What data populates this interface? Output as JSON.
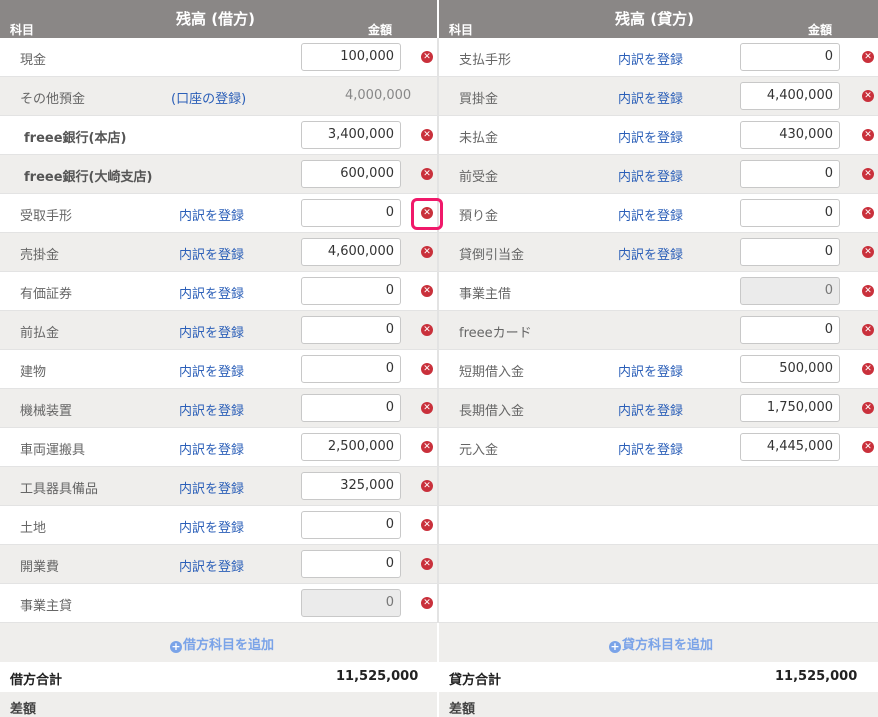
{
  "header": {
    "debit_title": "残高 (借方)",
    "credit_title": "残高 (貸方)",
    "account_label": "科目",
    "amount_label": "金額"
  },
  "debit": [
    {
      "name": "現金",
      "link": "",
      "amount": "100,000",
      "kind": "input",
      "del": true
    },
    {
      "name": "その他預金",
      "link": "(口座の登録)",
      "amount": "4,000,000",
      "kind": "static",
      "del": false
    },
    {
      "name": "freee銀行(本店)",
      "link": "",
      "amount": "3,400,000",
      "kind": "input",
      "del": true,
      "bold": true
    },
    {
      "name": "freee銀行(大崎支店)",
      "link": "",
      "amount": "600,000",
      "kind": "input",
      "del": true,
      "bold": true
    },
    {
      "name": "受取手形",
      "link": "内訳を登録",
      "amount": "0",
      "kind": "input",
      "del": true
    },
    {
      "name": "売掛金",
      "link": "内訳を登録",
      "amount": "4,600,000",
      "kind": "input",
      "del": true
    },
    {
      "name": "有価証券",
      "link": "内訳を登録",
      "amount": "0",
      "kind": "input",
      "del": true
    },
    {
      "name": "前払金",
      "link": "内訳を登録",
      "amount": "0",
      "kind": "input",
      "del": true
    },
    {
      "name": "建物",
      "link": "内訳を登録",
      "amount": "0",
      "kind": "input",
      "del": true
    },
    {
      "name": "機械装置",
      "link": "内訳を登録",
      "amount": "0",
      "kind": "input",
      "del": true
    },
    {
      "name": "車両運搬具",
      "link": "内訳を登録",
      "amount": "2,500,000",
      "kind": "input",
      "del": true
    },
    {
      "name": "工具器具備品",
      "link": "内訳を登録",
      "amount": "325,000",
      "kind": "input",
      "del": true
    },
    {
      "name": "土地",
      "link": "内訳を登録",
      "amount": "0",
      "kind": "input",
      "del": true
    },
    {
      "name": "開業費",
      "link": "内訳を登録",
      "amount": "0",
      "kind": "input",
      "del": true
    },
    {
      "name": "事業主貸",
      "link": "",
      "amount": "0",
      "kind": "disabled",
      "del": true
    }
  ],
  "credit": [
    {
      "name": "支払手形",
      "link": "内訳を登録",
      "amount": "0",
      "kind": "input",
      "del": true
    },
    {
      "name": "買掛金",
      "link": "内訳を登録",
      "amount": "4,400,000",
      "kind": "input",
      "del": true
    },
    {
      "name": "未払金",
      "link": "内訳を登録",
      "amount": "430,000",
      "kind": "input",
      "del": true
    },
    {
      "name": "前受金",
      "link": "内訳を登録",
      "amount": "0",
      "kind": "input",
      "del": true
    },
    {
      "name": "預り金",
      "link": "内訳を登録",
      "amount": "0",
      "kind": "input",
      "del": true
    },
    {
      "name": "貸倒引当金",
      "link": "内訳を登録",
      "amount": "0",
      "kind": "input",
      "del": true
    },
    {
      "name": "事業主借",
      "link": "",
      "amount": "0",
      "kind": "disabled",
      "del": true
    },
    {
      "name": "freeeカード",
      "link": "",
      "amount": "0",
      "kind": "input",
      "del": true
    },
    {
      "name": "短期借入金",
      "link": "内訳を登録",
      "amount": "500,000",
      "kind": "input",
      "del": true
    },
    {
      "name": "長期借入金",
      "link": "内訳を登録",
      "amount": "1,750,000",
      "kind": "input",
      "del": true
    },
    {
      "name": "元入金",
      "link": "内訳を登録",
      "amount": "4,445,000",
      "kind": "input",
      "del": true
    }
  ],
  "actions": {
    "add_debit": "借方科目を追加",
    "add_credit": "貸方科目を追加"
  },
  "totals": {
    "debit_label": "借方合計",
    "debit_value": "11,525,000",
    "credit_label": "貸方合計",
    "credit_value": "11,525,000",
    "diff_label": "差額"
  },
  "colors": {
    "header_bg": "#8a8786",
    "link": "#2b5fb8",
    "delete": "#c9303b",
    "highlight": "#f0196a",
    "add_link": "#7aa3e8"
  },
  "icons": {
    "delete": "close-circle-icon",
    "add": "plus-circle-icon"
  }
}
